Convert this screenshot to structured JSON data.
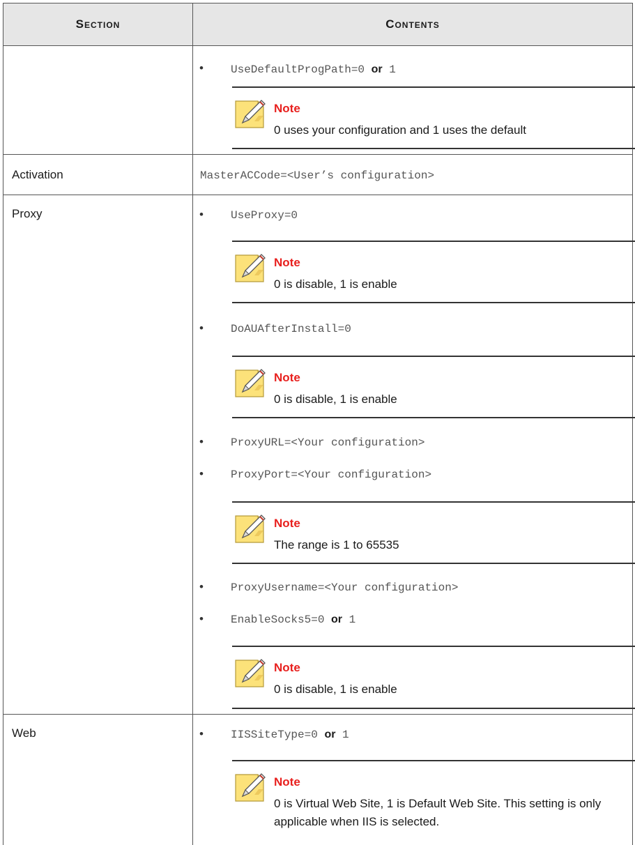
{
  "table": {
    "headers": {
      "section": "Section",
      "contents": "Contents"
    }
  },
  "rows": {
    "cont": {
      "item": {
        "key": "UseDefaultProgPath=0",
        "or": "or",
        "val": "1"
      },
      "note": {
        "title": "Note",
        "text": "0 uses your configuration and 1 uses the default"
      }
    },
    "activation": {
      "section": "Activation",
      "code": "MasterACCode=<User’s configuration>"
    },
    "proxy": {
      "section": "Proxy",
      "use_proxy": "UseProxy=0",
      "note1": {
        "title": "Note",
        "text": "0 is disable, 1 is enable"
      },
      "doau": "DoAUAfterInstall=0",
      "note2": {
        "title": "Note",
        "text": "0 is disable, 1 is enable"
      },
      "proxy_url": "ProxyURL=<Your configuration>",
      "proxy_port": "ProxyPort=<Your configuration>",
      "note3": {
        "title": "Note",
        "text": "The range is 1 to 65535"
      },
      "proxy_username": "ProxyUsername=<Your configuration>",
      "socks": {
        "key": "EnableSocks5=0",
        "or": "or",
        "val": "1"
      },
      "note4": {
        "title": "Note",
        "text": "0 is disable, 1 is enable"
      }
    },
    "web": {
      "section": "Web",
      "iis": {
        "key": "IISSiteType=0",
        "or": "or",
        "val": "1"
      },
      "note": {
        "title": "Note",
        "text": "0 is Virtual Web Site, 1 is Default Web Site. This setting is only applicable when IIS is selected."
      }
    }
  },
  "bullet_glyph": "•",
  "note_icon": "note-pencil-icon",
  "colors": {
    "note_title": "#e8201e",
    "header_bg": "#e6e6e6"
  }
}
